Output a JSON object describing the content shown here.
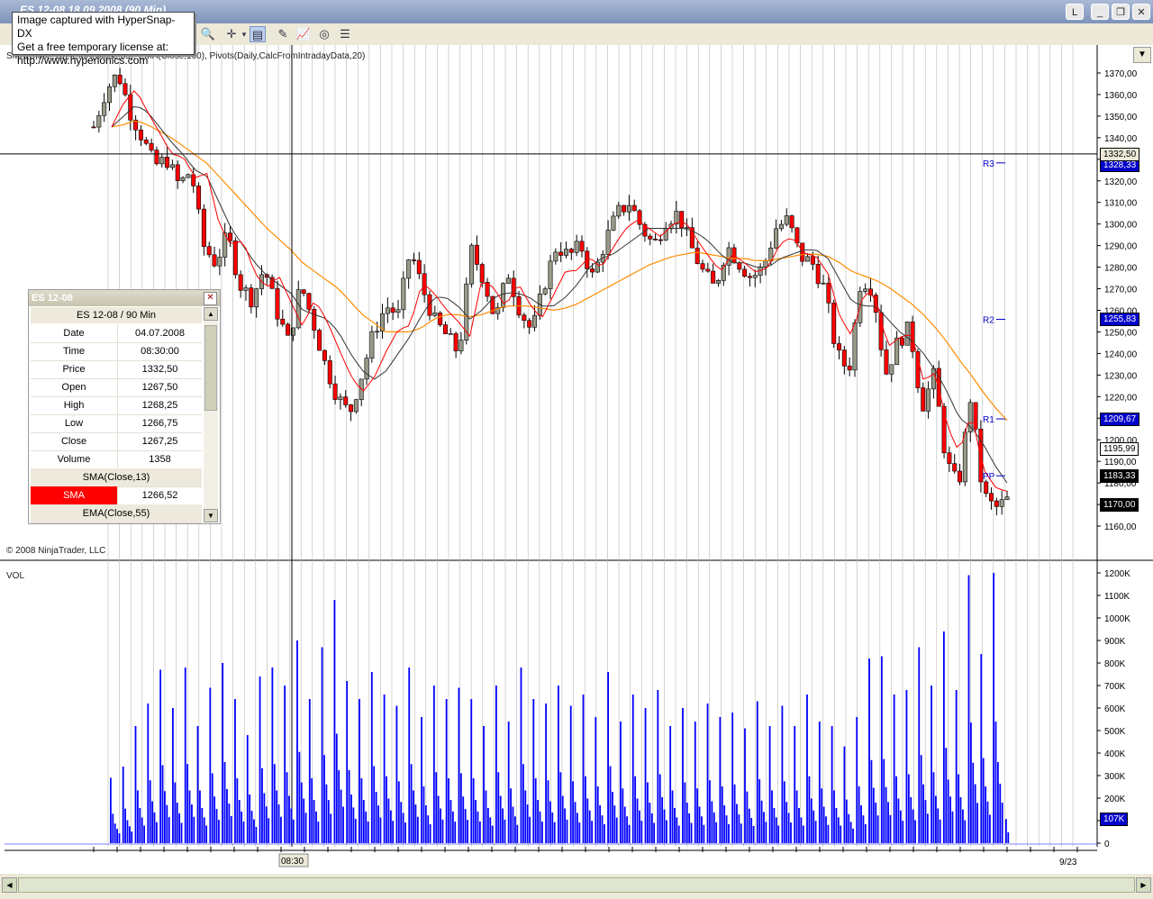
{
  "window": {
    "title": "ES 12-08 18.09.2008 (90 Min)"
  },
  "watermark": {
    "line1": "Image captured with HyperSnap-DX",
    "line2": "Get a free temporary license at:",
    "line3": "http://www.hyperionics.com"
  },
  "indicators_text": "SMA(Close,13), EMA(Close,55), EMA(Close,100), Pivots(Daily,CalcFromIntradayData,20)",
  "copyright": "© 2008 NinjaTrader, LLC",
  "vol_label": "VOL",
  "cursor": {
    "price_label": "1332,50",
    "time_label": "08:30"
  },
  "databox": {
    "title": "ES 12-08",
    "subtitle": "ES 12-08 / 90 Min",
    "rows": [
      {
        "k": "Date",
        "v": "04.07.2008"
      },
      {
        "k": "Time",
        "v": "08:30:00"
      },
      {
        "k": "Price",
        "v": "1332,50"
      },
      {
        "k": "Open",
        "v": "1267,50"
      },
      {
        "k": "High",
        "v": "1268,25"
      },
      {
        "k": "Low",
        "v": "1266,75"
      },
      {
        "k": "Close",
        "v": "1267,25"
      },
      {
        "k": "Volume",
        "v": "1358"
      }
    ],
    "sma_section": "SMA(Close,13)",
    "sma_label": "SMA",
    "sma_value": "1266,52",
    "ema_section": "EMA(Close,55)"
  },
  "pivots": [
    {
      "label": "R3",
      "price": 1328.33,
      "badge": "1328,33"
    },
    {
      "label": "R2",
      "price": 1255.83,
      "badge": "1255,83"
    },
    {
      "label": "R1",
      "price": 1209.67,
      "badge": "1209,67"
    },
    {
      "label": "PP",
      "price": 1183.33,
      "badge": "1183,33"
    }
  ],
  "other_badges": [
    {
      "value": 1195.99,
      "text": "1195,99",
      "color": "#ffffff"
    },
    {
      "value": 1170.0,
      "text": "1170,00",
      "color": "#000000"
    }
  ],
  "x_axis_labels": [
    "08:30",
    "9/23"
  ],
  "chart_data": {
    "type": "candlestick",
    "price_axis": {
      "ticks": [
        1370,
        1360,
        1350,
        1340,
        1330,
        1320,
        1310,
        1300,
        1290,
        1280,
        1270,
        1260,
        1250,
        1240,
        1230,
        1220,
        1210,
        1200,
        1190,
        1180,
        1170,
        1160
      ],
      "tick_labels": [
        "1370,00",
        "1360,00",
        "1350,00",
        "1340,00",
        "1330,00",
        "1320,00",
        "1310,00",
        "1300,00",
        "1290,00",
        "1280,00",
        "1270,00",
        "1260,00",
        "1250,00",
        "1240,00",
        "1230,00",
        "1220,00",
        "1210,00",
        "1200,00",
        "1190,00",
        "1180,00",
        "1170,00",
        "1160,00"
      ]
    },
    "volume_axis": {
      "ticks": [
        0,
        100,
        200,
        300,
        400,
        500,
        600,
        700,
        800,
        900,
        1000,
        1100,
        1200
      ],
      "tick_labels": [
        "0",
        "100K",
        "200K",
        "300K",
        "400K",
        "500K",
        "600K",
        "700K",
        "800K",
        "900K",
        "1000K",
        "1100K",
        "1200K"
      ],
      "last_badge": "107K"
    },
    "price_path": [
      1345,
      1362,
      1370,
      1352,
      1340,
      1327,
      1330,
      1318,
      1325,
      1290,
      1282,
      1295,
      1272,
      1265,
      1280,
      1260,
      1245,
      1272,
      1255,
      1235,
      1220,
      1212,
      1230,
      1250,
      1262,
      1258,
      1288,
      1270,
      1255,
      1248,
      1240,
      1288,
      1275,
      1255,
      1278,
      1260,
      1250,
      1272,
      1290,
      1285,
      1290,
      1275,
      1292,
      1305,
      1310,
      1298,
      1290,
      1302,
      1305,
      1290,
      1278,
      1270,
      1290,
      1282,
      1275,
      1280,
      1298,
      1302,
      1285,
      1282,
      1270,
      1240,
      1232,
      1275,
      1270,
      1230,
      1245,
      1252,
      1215,
      1230,
      1190,
      1178,
      1220,
      1175,
      1168,
      1172
    ],
    "sma13_path": [
      1345,
      1350,
      1355,
      1352,
      1345,
      1338,
      1332,
      1325,
      1322,
      1310,
      1298,
      1290,
      1282,
      1276,
      1272,
      1268,
      1260,
      1258,
      1256,
      1250,
      1240,
      1232,
      1228,
      1232,
      1240,
      1248,
      1258,
      1266,
      1266,
      1262,
      1256,
      1260,
      1266,
      1268,
      1268,
      1266,
      1262,
      1262,
      1266,
      1272,
      1280,
      1284,
      1286,
      1290,
      1294,
      1298,
      1298,
      1298,
      1298,
      1296,
      1292,
      1286,
      1282,
      1282,
      1280,
      1280,
      1284,
      1286,
      1288,
      1288,
      1284,
      1274,
      1264,
      1262,
      1262,
      1256,
      1250,
      1246,
      1240,
      1232,
      1222,
      1210,
      1206,
      1198,
      1188,
      1180
    ],
    "ema55_path": [
      1345,
      1346,
      1348,
      1346,
      1343,
      1340,
      1336,
      1332,
      1328,
      1322,
      1316,
      1310,
      1304,
      1298,
      1293,
      1288,
      1282,
      1278,
      1274,
      1270,
      1264,
      1258,
      1254,
      1250,
      1250,
      1250,
      1252,
      1256,
      1258,
      1258,
      1257,
      1258,
      1260,
      1262,
      1262,
      1262,
      1261,
      1260,
      1261,
      1263,
      1266,
      1269,
      1272,
      1275,
      1278,
      1281,
      1283,
      1285,
      1286,
      1287,
      1286,
      1285,
      1284,
      1284,
      1283,
      1283,
      1284,
      1285,
      1286,
      1286,
      1285,
      1282,
      1278,
      1276,
      1274,
      1271,
      1267,
      1263,
      1258,
      1252,
      1245,
      1237,
      1230,
      1222,
      1215,
      1209
    ],
    "volume_k": [
      290,
      340,
      520,
      620,
      770,
      600,
      780,
      520,
      690,
      800,
      640,
      480,
      740,
      780,
      700,
      900,
      640,
      870,
      1080,
      720,
      640,
      760,
      660,
      610,
      780,
      560,
      700,
      640,
      690,
      640,
      520,
      700,
      540,
      780,
      640,
      620,
      700,
      610,
      660,
      560,
      760,
      540,
      660,
      600,
      680,
      520,
      600,
      540,
      620,
      560,
      580,
      510,
      630,
      520,
      610,
      520,
      660,
      540,
      520,
      430,
      560,
      820,
      830,
      660,
      680,
      870,
      700,
      940,
      680,
      1190,
      840,
      1200,
      107
    ],
    "volume_color": "#0000ff",
    "up_color": "#9a9a8a",
    "down_color": "#ff0000",
    "sma_color": "#ff0000",
    "ema55_color": "#333333",
    "ema100_color": "#ff8c00"
  }
}
